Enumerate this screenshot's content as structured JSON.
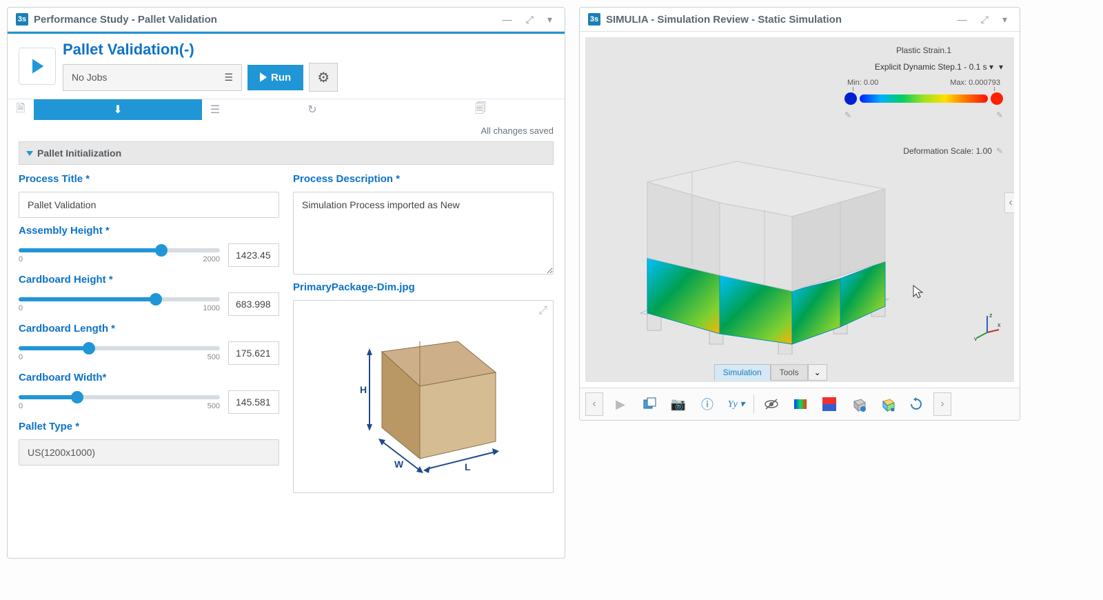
{
  "left": {
    "window_title": "Performance Study - Pallet Validation",
    "main_title": "Pallet Validation(-)",
    "jobs_value": "No Jobs",
    "run_label": "Run",
    "saved_status": "All changes saved",
    "section_title": "Pallet Initialization",
    "fields": {
      "process_title": {
        "label": "Process Title *",
        "value": "Pallet Validation"
      },
      "process_desc": {
        "label": "Process Description *",
        "value": "Simulation Process imported as New"
      },
      "assembly_height": {
        "label": "Assembly Height *",
        "min": "0",
        "max": "2000",
        "value": "1423.45",
        "pct": 71
      },
      "cardboard_height": {
        "label": "Cardboard Height *",
        "min": "0",
        "max": "1000",
        "value": "683.998",
        "pct": 68
      },
      "cardboard_length": {
        "label": "Cardboard Length *",
        "min": "0",
        "max": "500",
        "value": "175.621",
        "pct": 35
      },
      "cardboard_width": {
        "label": "Cardboard Width*",
        "min": "0",
        "max": "500",
        "value": "145.581",
        "pct": 29
      },
      "pallet_type": {
        "label": "Pallet Type *",
        "value": "US(1200x1000)"
      },
      "image_name": "PrimaryPackage-Dim.jpg"
    }
  },
  "right": {
    "window_title": "SIMULIA - Simulation Review - Static Simulation",
    "strain_label": "Plastic Strain.1",
    "step_label": "Explicit Dynamic Step.1 - 0.1 s",
    "min_label": "Min: 0.00",
    "max_label": "Max: 0.000793",
    "def_scale_label": "Deformation Scale: 1.00",
    "tabs": {
      "simulation": "Simulation",
      "tools": "Tools"
    }
  },
  "box_dims": {
    "h": "H",
    "w": "W",
    "l": "L"
  }
}
